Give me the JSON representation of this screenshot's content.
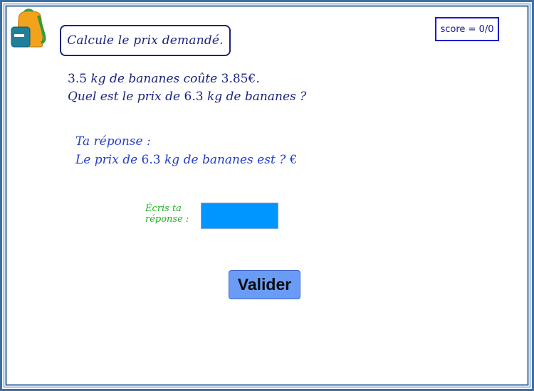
{
  "instruction": "Calcule le prix demandé.",
  "score": {
    "label": "score = 0/0"
  },
  "problem": {
    "line1_num1": "3.5",
    "line1_unit1": "kg",
    "line1_text1": "de bananes coûte",
    "line1_num2": "3.85",
    "line1_currency": "€.",
    "line2_text1": "Quel est le prix de",
    "line2_num": "6.3",
    "line2_unit": "kg",
    "line2_text2": "de bananes ?"
  },
  "answer": {
    "heading": "Ta réponse :",
    "text1": "Le prix de",
    "num": "6.3",
    "unit": "kg",
    "text2": "de bananes est ?",
    "currency": "€"
  },
  "write_label_line1": "Écris ta",
  "write_label_line2": "réponse :",
  "answer_input": {
    "value": ""
  },
  "validate_button": {
    "label": "Valider"
  },
  "icons": {
    "logo": "backpack-icon"
  },
  "colors": {
    "text_dark_blue": "#1a237e",
    "text_blue": "#2340c8",
    "label_green": "#22b022",
    "input_blue": "#0096ff",
    "button_blue": "#6a9cf7",
    "frame_blue": "#3c6ea8"
  }
}
